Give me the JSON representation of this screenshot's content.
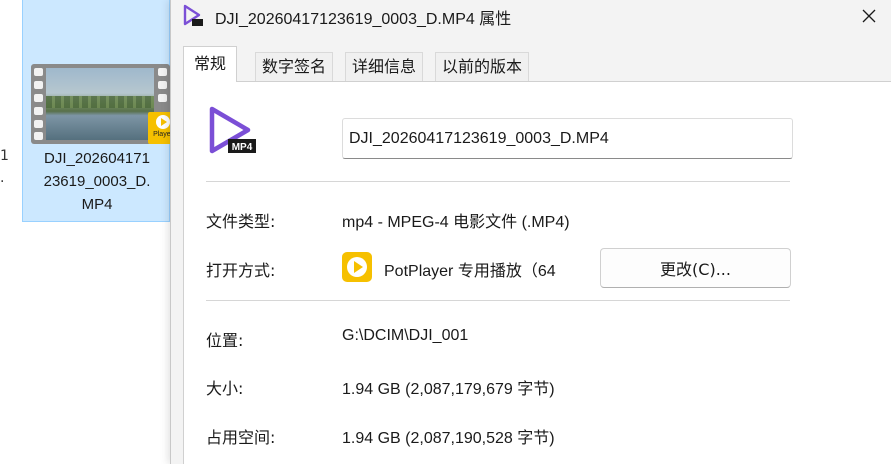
{
  "explorer": {
    "file_name": "DJI_202604171\n23619_0003_D.\nMP4",
    "badge_text": "Player",
    "edge_marks": [
      "1",
      "."
    ]
  },
  "dialog": {
    "title": "DJI_20260417123619_0003_D.MP4 属性",
    "close_symbol": "✕",
    "tabs": [
      {
        "label": "常规",
        "active": true
      },
      {
        "label": "数字签名",
        "active": false
      },
      {
        "label": "详细信息",
        "active": false
      },
      {
        "label": "以前的版本",
        "active": false
      }
    ],
    "file_icon_badge": "MP4",
    "name_value": "DJI_20260417123619_0003_D.MP4",
    "file_type_label": "文件类型:",
    "file_type_value": "mp4 - MPEG-4 电影文件 (.MP4)",
    "opens_with_label": "打开方式:",
    "opens_with_value": "PotPlayer 专用播放（64",
    "change_button": "更改(C)...",
    "location_label": "位置:",
    "location_value": "G:\\DCIM\\DJI_001",
    "size_label": "大小:",
    "size_value": "1.94 GB (2,087,179,679 字节)",
    "size_on_disk_label": "占用空间:",
    "size_on_disk_value": "1.94 GB (2,087,190,528 字节)"
  },
  "colors": {
    "accent_purple": "#7b4fd6",
    "potplayer_yellow": "#f6c000",
    "selection_blue": "#cce8ff"
  }
}
